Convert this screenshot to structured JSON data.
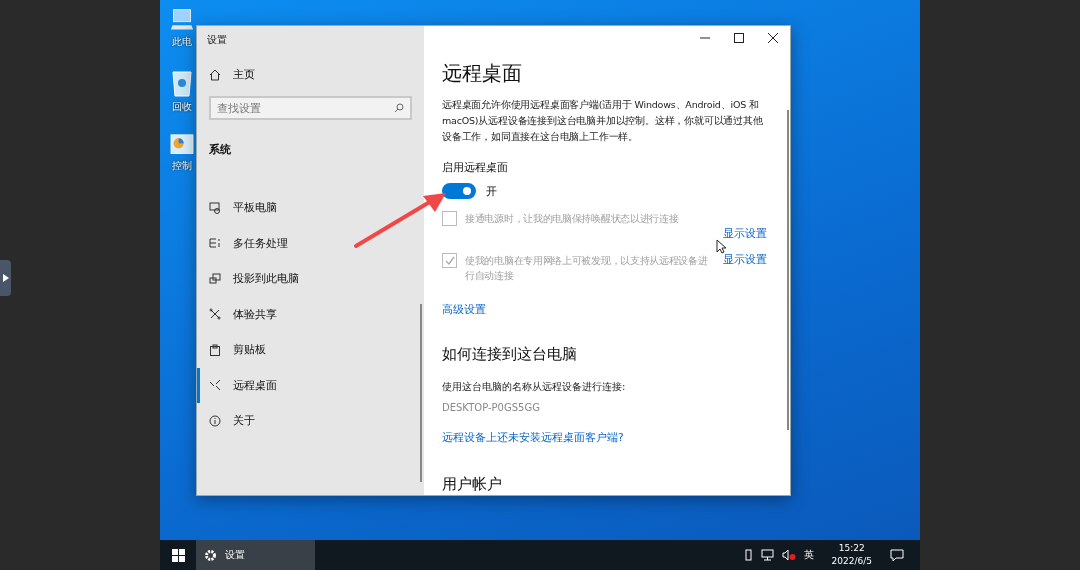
{
  "desktop_icons": [
    {
      "label": "此电"
    },
    {
      "label": "回收"
    },
    {
      "label": "控制"
    }
  ],
  "window": {
    "title": "设置",
    "home": "主页",
    "search": {
      "placeholder": "查找设置"
    },
    "section": "系统",
    "nav": [
      {
        "label": "平板电脑",
        "selected": false
      },
      {
        "label": "多任务处理",
        "selected": false
      },
      {
        "label": "投影到此电脑",
        "selected": false
      },
      {
        "label": "体验共享",
        "selected": false
      },
      {
        "label": "剪贴板",
        "selected": false
      },
      {
        "label": "远程桌面",
        "selected": true
      },
      {
        "label": "关于",
        "selected": false
      }
    ]
  },
  "page": {
    "title": "远程桌面",
    "description": "远程桌面允许你使用远程桌面客户端(适用于 Windows、Android、iOS 和 macOS)从远程设备连接到这台电脑并加以控制。这样，你就可以通过其他设备工作，如同直接在这台电脑上工作一样。",
    "toggle": {
      "label": "启用远程桌面",
      "on": true,
      "state_text": "开"
    },
    "options": [
      {
        "text": "接通电源时，让我的电脑保持唤醒状态以进行连接",
        "checked": false,
        "disabled": true,
        "link": "显示设置"
      },
      {
        "text": "使我的电脑在专用网络上可被发现，以支持从远程设备进行自动连接",
        "checked": true,
        "disabled": true,
        "link": "显示设置"
      }
    ],
    "advanced_link": "高级设置",
    "connect_heading": "如何连接到这台电脑",
    "connect_text": "使用这台电脑的名称从远程设备进行连接:",
    "pc_name": "DESKTOP-P0GS5GG",
    "client_link": "远程设备上还未安装远程桌面客户端?",
    "accounts_heading": "用户帐户"
  },
  "taskbar": {
    "app": "设置",
    "language": "英",
    "time": "15:22",
    "date": "2022/6/5"
  }
}
